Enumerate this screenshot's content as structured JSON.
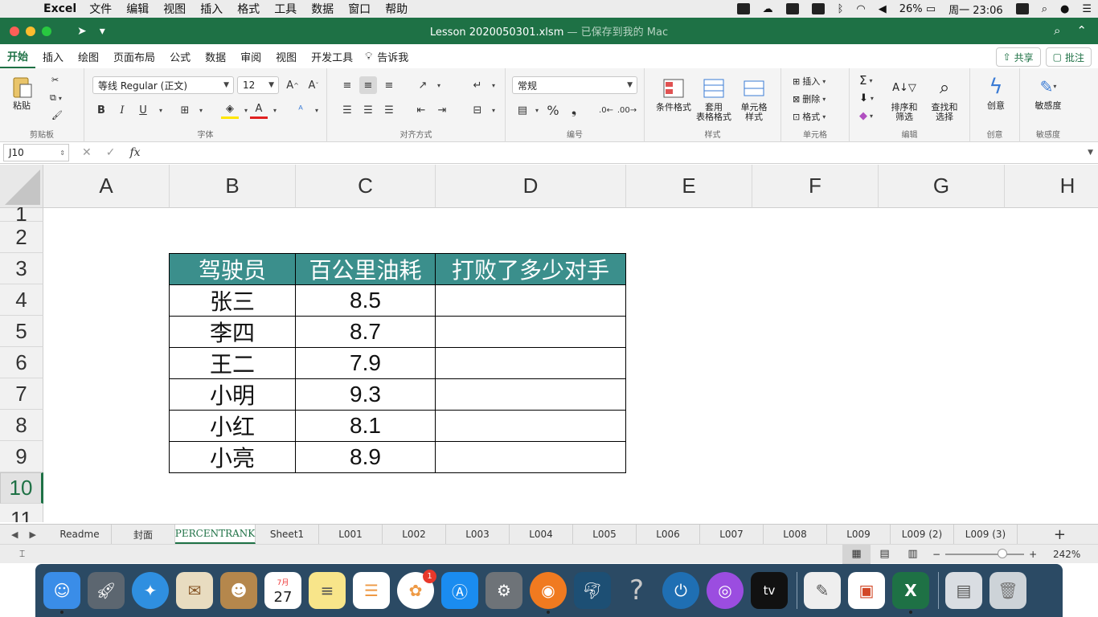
{
  "menubar": {
    "app": "Excel",
    "items": [
      "文件",
      "编辑",
      "视图",
      "插入",
      "格式",
      "工具",
      "数据",
      "窗口",
      "帮助"
    ],
    "battery": "26%",
    "clock": "周一 23:06"
  },
  "window": {
    "title": "Lesson 2020050301.xlsm",
    "title_suffix": " — 已保存到我的 Mac"
  },
  "ribbon": {
    "tabs": [
      "开始",
      "插入",
      "绘图",
      "页面布局",
      "公式",
      "数据",
      "审阅",
      "视图",
      "开发工具"
    ],
    "tell_me": "告诉我",
    "share": "共享",
    "comments": "批注",
    "clipboard": {
      "paste": "粘贴",
      "label": "剪贴板"
    },
    "font": {
      "name": "等线 Regular (正文)",
      "size": "12",
      "label": "字体",
      "bold": "B",
      "italic": "I",
      "underline": "U"
    },
    "alignment": {
      "label": "对齐方式"
    },
    "number": {
      "format": "常规",
      "label": "编号"
    },
    "styles": {
      "conditional": "条件格式",
      "table_line1": "套用",
      "table_line2": "表格格式",
      "cell_line1": "单元格",
      "cell_line2": "样式",
      "label": "样式"
    },
    "cells": {
      "insert": "插入",
      "delete": "删除",
      "format": "格式",
      "label": "单元格"
    },
    "editing": {
      "sort_line1": "排序和",
      "sort_line2": "筛选",
      "find_line1": "查找和",
      "find_line2": "选择",
      "label": "编辑"
    },
    "creative": {
      "btn": "创意",
      "label": "创意"
    },
    "sensitivity": {
      "btn": "敏感度",
      "label": "敏感度"
    }
  },
  "formula_bar": {
    "name_box": "J10",
    "fx": "fx",
    "content": ""
  },
  "sheet": {
    "columns": [
      "A",
      "B",
      "C",
      "D",
      "E",
      "F",
      "G",
      "H"
    ],
    "rows": [
      "1",
      "2",
      "3",
      "4",
      "5",
      "6",
      "7",
      "8",
      "9",
      "10",
      "11"
    ],
    "selected_row": "10",
    "table": {
      "headers": [
        "驾驶员",
        "百公里油耗",
        "打败了多少对手"
      ],
      "rows": [
        [
          "张三",
          "8.5",
          ""
        ],
        [
          "李四",
          "8.7",
          ""
        ],
        [
          "王二",
          "7.9",
          ""
        ],
        [
          "小明",
          "9.3",
          ""
        ],
        [
          "小红",
          "8.1",
          ""
        ],
        [
          "小亮",
          "8.9",
          ""
        ]
      ],
      "header_color": "#3b8f8c"
    }
  },
  "sheet_tabs": {
    "tabs": [
      "Readme",
      "封面",
      "PERCENTRANK",
      "Sheet1",
      "L001",
      "L002",
      "L003",
      "L004",
      "L005",
      "L006",
      "L007",
      "L008",
      "L009",
      "L009 (2)",
      "L009 (3)"
    ],
    "active": "PERCENTRANK"
  },
  "status_bar": {
    "zoom": "242%",
    "zoom_level": 0.72
  },
  "dock": {
    "calendar_month": "7月",
    "calendar_day": "27",
    "photos_badge": "1",
    "apple_tv": "tv"
  },
  "colors": {
    "excel_green": "#1e7145",
    "accent": "#3b8f8c"
  }
}
